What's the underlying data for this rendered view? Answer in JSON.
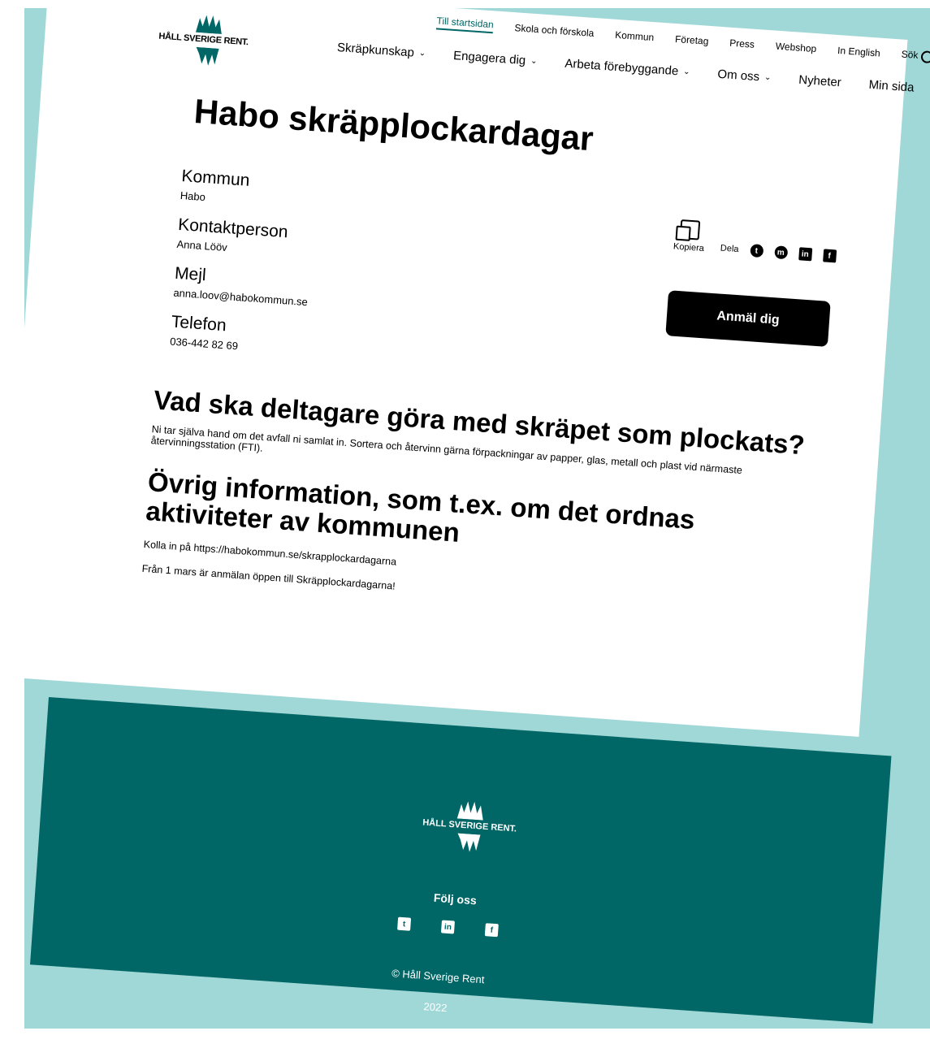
{
  "logo": {
    "text": "HÅLL SVERIGE RENT."
  },
  "topnav": [
    "Till startsidan",
    "Skola och förskola",
    "Kommun",
    "Företag",
    "Press",
    "Webshop",
    "In English",
    "Sök"
  ],
  "mainnav": [
    {
      "label": "Skräpkunskap",
      "has_dropdown": true
    },
    {
      "label": "Engagera dig",
      "has_dropdown": true
    },
    {
      "label": "Arbeta förebyggande",
      "has_dropdown": true
    },
    {
      "label": "Om oss",
      "has_dropdown": true
    },
    {
      "label": "Nyheter",
      "has_dropdown": false
    },
    {
      "label": "Min sida",
      "has_dropdown": false
    }
  ],
  "page": {
    "title": "Habo skräpplockardagar",
    "fields": [
      {
        "label": "Kommun",
        "value": "Habo"
      },
      {
        "label": "Kontaktperson",
        "value": "Anna Lööv"
      },
      {
        "label": "Mejl",
        "value": "anna.loov@habokommun.se"
      },
      {
        "label": "Telefon",
        "value": "036-442 82 69"
      }
    ],
    "copy_label": "Kopiera",
    "share_label": "Dela",
    "social_icons": [
      "twitter-icon",
      "messenger-icon",
      "linkedin-icon",
      "facebook-icon"
    ],
    "signup_button": "Anmäl dig",
    "section1_heading": "Vad ska deltagare göra med skräpet som plockats?",
    "section1_text": "Ni tar själva hand om det avfall ni samlat in. Sortera och återvinn gärna förpackningar av papper, glas, metall och plast vid närmaste återvinningsstation (FTI).",
    "section2_heading": "Övrig information, som t.ex. om det ordnas aktiviteter av kommunen",
    "section2_text1": "Kolla in på https://habokommun.se/skrapplockardagarna",
    "section2_text2": "Från 1 mars är anmälan öppen till Skräpplockardagarna!"
  },
  "footer": {
    "logo_text": "HÅLL SVERIGE RENT.",
    "follow_label": "Följ oss",
    "social_icons": [
      "twitter-icon",
      "linkedin-icon",
      "facebook-icon"
    ],
    "copyright": "© Håll Sverige Rent",
    "year": "2022"
  },
  "colors": {
    "teal": "#016766",
    "light_teal": "#a0d7d7"
  }
}
